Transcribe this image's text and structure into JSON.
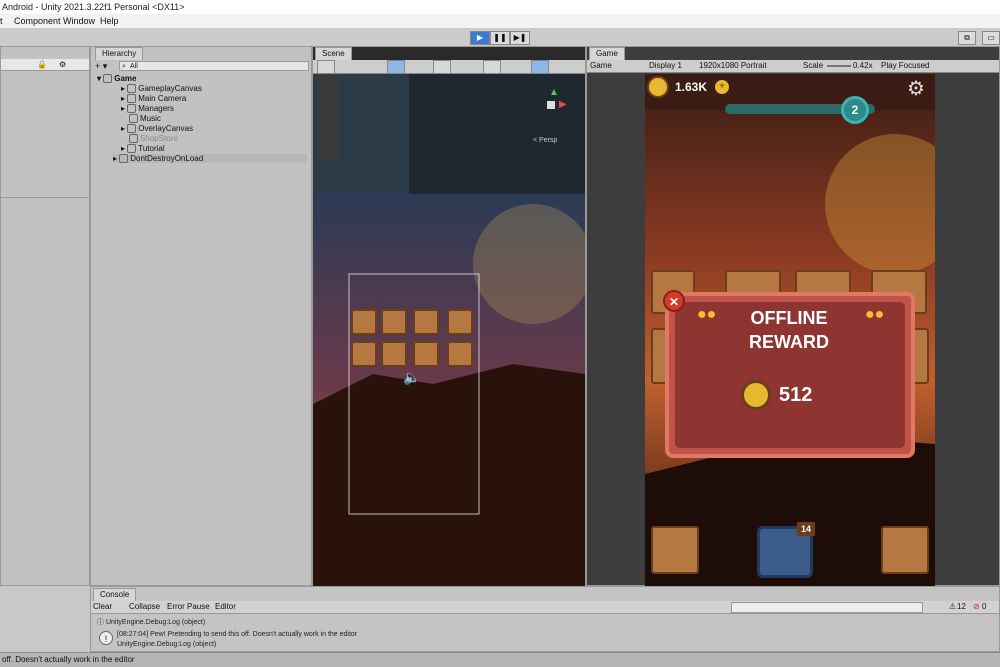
{
  "window": {
    "title": "Android - Unity 2021.3.22f1 Personal <DX11>"
  },
  "menu": [
    "t",
    "Component",
    "Window",
    "Help"
  ],
  "hierarchy": {
    "tab": "Hierarchy",
    "search_placeholder": "All",
    "root": "Game",
    "items": [
      "GameplayCanvas",
      "Main Camera",
      "Managers",
      "Music",
      "OverlayCanvas",
      "ShopStore",
      "Tutorial"
    ],
    "dont_destroy": "DontDestroyOnLoad"
  },
  "scene": {
    "tab": "Scene",
    "gizmo_label": "< Persp"
  },
  "game": {
    "tab": "Game",
    "view_select": "Game",
    "display": "Display 1",
    "resolution": "1920x1080 Portrait",
    "scale_label": "Scale",
    "scale_value": "0.42x",
    "play_mode": "Play Focused",
    "coins": "1.63K",
    "level": "2",
    "reward_title_1": "OFFLINE",
    "reward_title_2": "REWARD",
    "reward_amount": "512",
    "chest_badge": "14",
    "colors": {
      "bg_dark": "#3a1a14",
      "dialog": "#c0544a",
      "dialog_inner": "#8e3532",
      "accent": "#f2c230"
    }
  },
  "console": {
    "tab": "Console",
    "buttons": [
      "Clear",
      "Collapse",
      "Error Pause",
      "Editor"
    ],
    "warn_count": "12",
    "error_count": "0",
    "lines": [
      "UnityEngine.Debug:Log (object)",
      "[08:27:04] Pew! Pretending to send this off. Doesn't actually work in the editor",
      "UnityEngine.Debug:Log (object)"
    ],
    "status": "off. Doesn't actually work in the editor"
  }
}
